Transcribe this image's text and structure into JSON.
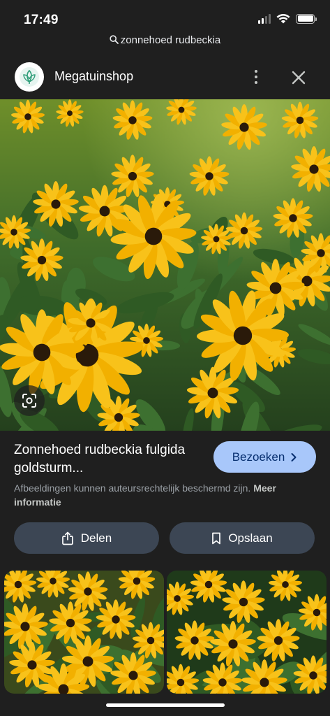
{
  "status": {
    "time": "17:49"
  },
  "search": {
    "query": "zonnehoed rudbeckia",
    "icon": "search-icon"
  },
  "header": {
    "site_name": "Megatuinshop",
    "logo": "megatuinshop-logo",
    "more_icon": "more-vert-icon",
    "close_icon": "close-icon"
  },
  "result": {
    "title": "Zonnehoed rudbeckia fulgida goldsturm...",
    "visit_label": "Bezoeken",
    "copyright_text": "Afbeeldingen kunnen auteursrechtelijk beschermd zijn.",
    "more_info_label": "Meer informatie"
  },
  "actions": {
    "share_label": "Delen",
    "save_label": "Opslaan"
  },
  "colors": {
    "background": "#1f1f1f",
    "visit_button": "#a8c7fa",
    "action_button": "#3c4654",
    "flower_petal": "#f5b800",
    "flower_center": "#2a1a0a"
  }
}
